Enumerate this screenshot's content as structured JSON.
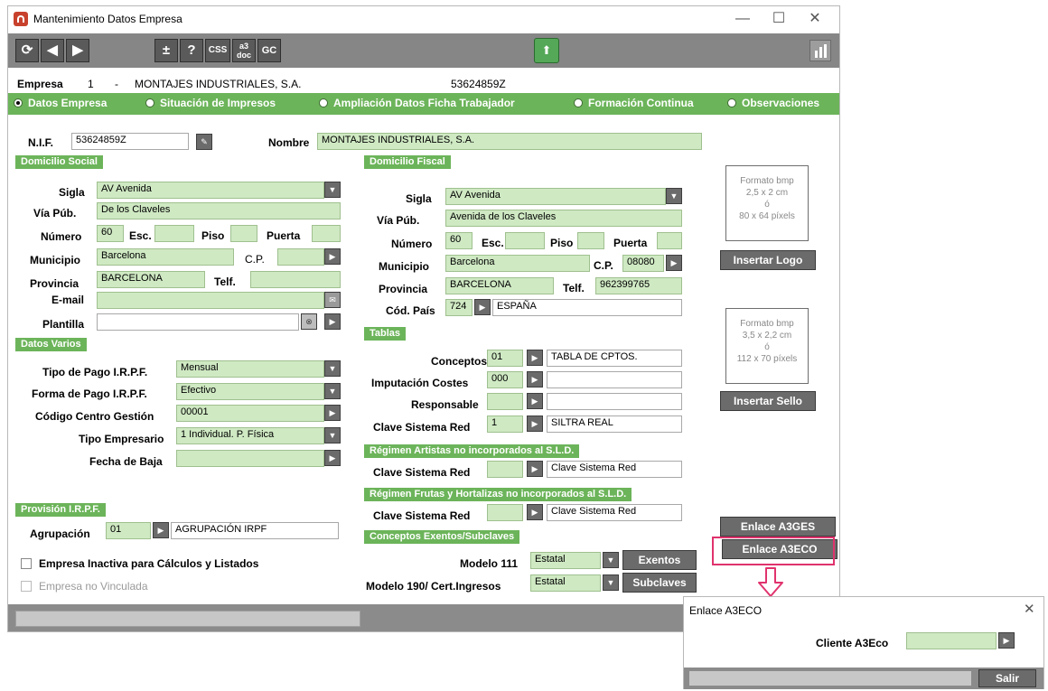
{
  "window": {
    "title": "Mantenimiento Datos Empresa",
    "controls": {
      "minimize": "—",
      "maximize": "☐",
      "close": "✕"
    }
  },
  "toolbar": {
    "refresh": "⟳",
    "prev": "◀",
    "next": "▶",
    "plusminus": "±",
    "help": "?",
    "css": "CSS",
    "a3doc_top": "a3",
    "a3doc_bot": "doc",
    "gc": "GC",
    "cloud": "⬆"
  },
  "empresa": {
    "label": "Empresa",
    "number": "1",
    "dash": "-",
    "name": "MONTAJES INDUSTRIALES, S.A.",
    "nif": "53624859Z"
  },
  "tabs": [
    {
      "label": "Datos Empresa",
      "selected": true
    },
    {
      "label": "Situación de Impresos",
      "selected": false
    },
    {
      "label": "Ampliación Datos Ficha Trabajador",
      "selected": false
    },
    {
      "label": "Formación Continua",
      "selected": false
    },
    {
      "label": "Observaciones",
      "selected": false
    }
  ],
  "nif": {
    "label": "N.I.F.",
    "value": "53624859Z",
    "nombre_label": "Nombre",
    "nombre_value": "MONTAJES INDUSTRIALES, S.A."
  },
  "domicilio_social": {
    "title": "Domicilio Social",
    "sigla_label": "Sigla",
    "sigla_value": "AV Avenida",
    "via_label": "Vía Púb.",
    "via_value": "De los Claveles",
    "numero_label": "Número",
    "numero_value": "60",
    "esc_label": "Esc.",
    "piso_label": "Piso",
    "puerta_label": "Puerta",
    "municipio_label": "Municipio",
    "municipio_value": "Barcelona",
    "cp_label": "C.P.",
    "provincia_label": "Provincia",
    "provincia_value": "BARCELONA",
    "telf_label": "Telf.",
    "email_label": "E-mail",
    "plantilla_label": "Plantilla"
  },
  "domicilio_fiscal": {
    "title": "Domicilio Fiscal",
    "sigla_label": "Sigla",
    "sigla_value": "AV Avenida",
    "via_label": "Vía Púb.",
    "via_value": "Avenida de los Claveles",
    "numero_label": "Número",
    "numero_value": "60",
    "esc_label": "Esc.",
    "piso_label": "Piso",
    "puerta_label": "Puerta",
    "municipio_label": "Municipio",
    "municipio_value": "Barcelona",
    "cp_label": "C.P.",
    "cp_value": "08080",
    "provincia_label": "Provincia",
    "provincia_value": "BARCELONA",
    "telf_label": "Telf.",
    "telf_value": "962399765",
    "pais_label": "Cód. País",
    "pais_code": "724",
    "pais_name": "ESPAÑA"
  },
  "datos_varios": {
    "title": "Datos Varios",
    "tipo_pago_label": "Tipo de Pago I.R.P.F.",
    "tipo_pago_value": "Mensual",
    "forma_pago_label": "Forma de Pago I.R.P.F.",
    "forma_pago_value": "Efectivo",
    "centro_label": "Código Centro Gestión",
    "centro_value": "00001",
    "tipo_emp_label": "Tipo Empresario",
    "tipo_emp_value": "1 Individual. P. Física",
    "fecha_baja_label": "Fecha de Baja"
  },
  "tablas": {
    "title": "Tablas",
    "conceptos_label": "Conceptos",
    "conceptos_code": "01",
    "conceptos_name": "TABLA DE CPTOS.",
    "imputacion_label": "Imputación Costes",
    "imputacion_code": "000",
    "responsable_label": "Responsable",
    "clave_label": "Clave Sistema Red",
    "clave_code": "1",
    "clave_name": "SILTRA REAL"
  },
  "regimen_artistas": {
    "title": "Régimen Artistas no incorporados al S.L.D.",
    "clave_label": "Clave Sistema Red",
    "clave_name": "Clave Sistema Red"
  },
  "regimen_frutas": {
    "title": "Régimen Frutas y Hortalizas no incorporados al S.L.D.",
    "clave_label": "Clave Sistema Red",
    "clave_name": "Clave Sistema Red"
  },
  "conceptos_exentos": {
    "title": "Conceptos Exentos/Subclaves",
    "m111_label": "Modelo 111",
    "m111_value": "Estatal",
    "exentos_btn": "Exentos",
    "m190_label": "Modelo 190/ Cert.Ingresos",
    "m190_value": "Estatal",
    "subclaves_btn": "Subclaves"
  },
  "provision": {
    "title": "Provisión I.R.P.F.",
    "agrupacion_label": "Agrupación",
    "agrupacion_code": "01",
    "agrupacion_name": "AGRUPACIÓN IRPF"
  },
  "checks": {
    "inactiva": "Empresa Inactiva para Cálculos y Listados",
    "no_vinculada": "Empresa no Vinculada"
  },
  "logo": {
    "fmt": "Formato bmp",
    "size": "2,5 x 2 cm",
    "o": "ó",
    "px": "80 x 64 píxels",
    "btn": "Insertar Logo"
  },
  "sello": {
    "fmt": "Formato bmp",
    "size": "3,5 x 2,2 cm",
    "o": "ó",
    "px": "112 x 70 píxels",
    "btn": "Insertar Sello"
  },
  "enlaces": {
    "a3ges": "Enlace A3GES",
    "a3eco": "Enlace A3ECO"
  },
  "dialog": {
    "title": "Enlace A3ECO",
    "close": "✕",
    "cliente_label": "Cliente A3Eco",
    "salir": "Salir"
  },
  "colors": {
    "accent_green": "#6cb45a",
    "field_green": "#cfe9c3",
    "highlight": "#e0336d",
    "toolbar": "#868686"
  }
}
